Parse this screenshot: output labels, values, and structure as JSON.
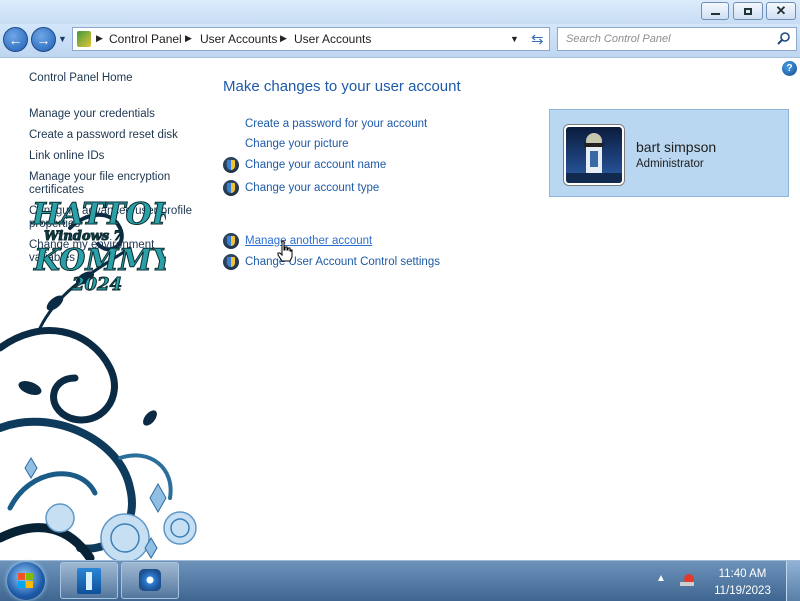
{
  "window": {
    "caption_buttons": [
      "minimize",
      "maximize",
      "close"
    ]
  },
  "nav": {
    "breadcrumbs": [
      "Control Panel",
      "User Accounts",
      "User Accounts"
    ],
    "search_placeholder": "Search Control Panel"
  },
  "sidebar": {
    "home": "Control Panel Home",
    "items": [
      "Manage your credentials",
      "Create a password reset disk",
      "Link online IDs",
      "Manage your file encryption certificates",
      "Configure advanced user profile properties",
      "Change my environment variables"
    ]
  },
  "main": {
    "heading": "Make changes to your user account",
    "tasks": [
      "Create a password for your account",
      "Change your picture",
      "Change your account name",
      "Change your account type",
      "Manage another account",
      "Change User Account Control settings"
    ]
  },
  "user": {
    "name": "bart simpson",
    "role": "Administrator"
  },
  "watermark": {
    "lines": [
      "HATTOR",
      "Windows 7",
      "KOMMY",
      "2024"
    ]
  },
  "taskbar": {
    "time": "11:40 AM",
    "date": "11/19/2023"
  },
  "colors": {
    "link": "#1e5aa8",
    "usercard": "#b9d7f1",
    "taskbar": "#4f76a0"
  }
}
